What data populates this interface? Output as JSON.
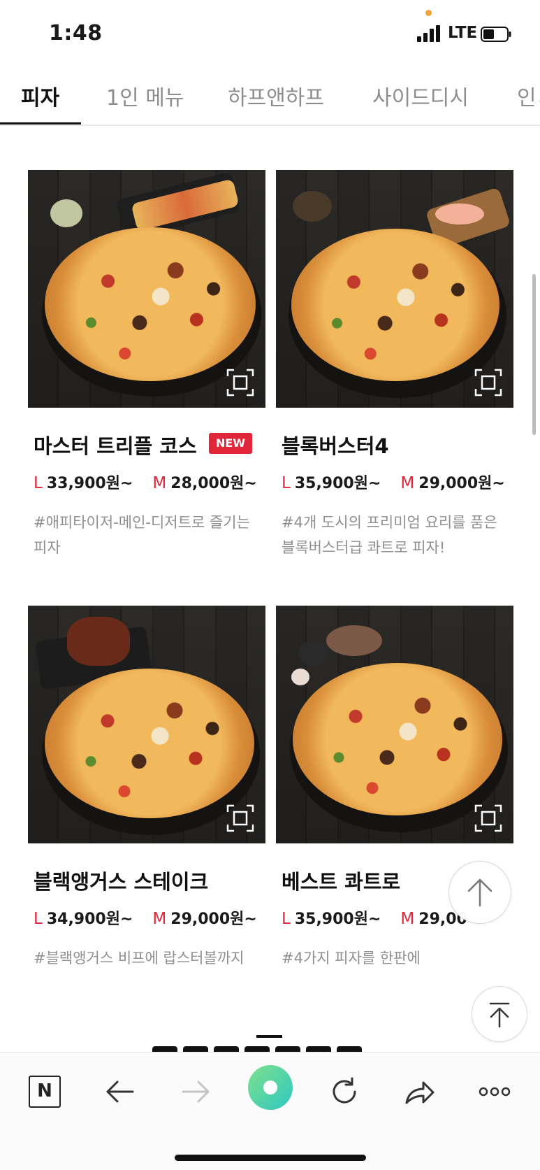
{
  "status_bar": {
    "time": "1:48",
    "network": "LTE"
  },
  "tabs": [
    {
      "label": "피자",
      "active": true
    },
    {
      "label": "1인 메뉴",
      "active": false
    },
    {
      "label": "하프앤하프",
      "active": false
    },
    {
      "label": "사이드디시",
      "active": false
    },
    {
      "label": "인ㅅ",
      "active": false
    }
  ],
  "products": [
    {
      "name": "마스터 트리플 코스",
      "badge": "NEW",
      "price_large_label": "L",
      "price_large": "33,900원~",
      "price_medium_label": "M",
      "price_medium": "28,000원~",
      "description": "#애피타이저-메인-디저트로 즐기는 피자"
    },
    {
      "name": "블록버스터4",
      "badge": "",
      "price_large_label": "L",
      "price_large": "35,900원~",
      "price_medium_label": "M",
      "price_medium": "29,000원~",
      "description": "#4개 도시의 프리미엄 요리를 품은 블록버스터급 콰트로 피자!"
    },
    {
      "name": "블랙앵거스 스테이크",
      "badge": "",
      "price_large_label": "L",
      "price_large": "34,900원~",
      "price_medium_label": "M",
      "price_medium": "29,000원~",
      "description": "#블랙앵거스 비프에 랍스터볼까지"
    },
    {
      "name": "베스트 콰트로",
      "badge": "",
      "price_large_label": "L",
      "price_large": "35,900원~",
      "price_medium_label": "M",
      "price_medium": "29,00",
      "description": "#4가지 피자를 한판에"
    }
  ],
  "toolbar": {
    "naver_label": "N"
  },
  "colors": {
    "accent": "#e2263a",
    "tab_active": "#111111",
    "tab_inactive": "#8d8d8d",
    "green_button": "#3fd6a0"
  },
  "icons": [
    "zoom-frame-icon",
    "scroll-up-icon",
    "scroll-top-icon",
    "back-arrow-icon",
    "forward-arrow-icon",
    "green-circle-icon",
    "reload-icon",
    "share-icon",
    "more-icon"
  ]
}
